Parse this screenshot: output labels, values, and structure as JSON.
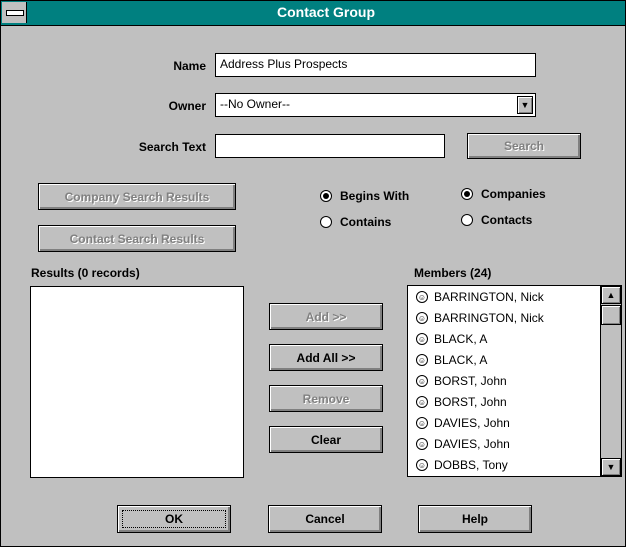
{
  "window": {
    "title": "Contact Group",
    "colors": {
      "titlebar": "#008080",
      "face": "#c0c0c0"
    }
  },
  "form": {
    "name_label": "Name",
    "name_value": "Address Plus Prospects",
    "owner_label": "Owner",
    "owner_value": "--No Owner--",
    "search_label": "Search Text",
    "search_value": "",
    "search_button": "Search"
  },
  "buttons": {
    "company_search_results": "Company Search Results",
    "contact_search_results": "Contact Search Results",
    "add": "Add >>",
    "add_all": "Add All >>",
    "remove": "Remove",
    "clear": "Clear",
    "ok": "OK",
    "cancel": "Cancel",
    "help": "Help"
  },
  "radios": {
    "begins_with": "Begins With",
    "contains": "Contains",
    "companies": "Companies",
    "contacts": "Contacts"
  },
  "results": {
    "label": "Results (0 records)"
  },
  "members": {
    "label": "Members (24)",
    "icon": "contact-person-icon",
    "items": [
      "BARRINGTON, Nick",
      "BARRINGTON, Nick",
      "BLACK, A",
      "BLACK, A",
      "BORST, John",
      "BORST, John",
      "DAVIES, John",
      "DAVIES, John",
      "DOBBS, Tony"
    ]
  }
}
